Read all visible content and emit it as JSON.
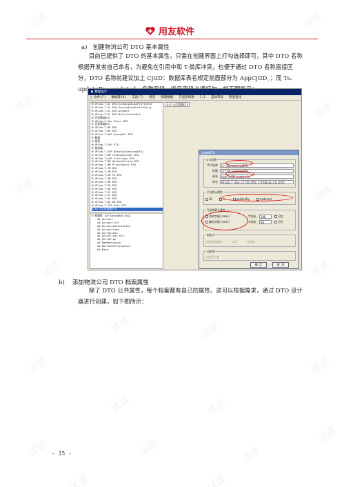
{
  "header": {
    "logo_text": "用友软件",
    "brand_color": "#c81c2a"
  },
  "watermark": "试读",
  "section_a": {
    "label": "a)",
    "heading": "创建物流公司 DTO 基本属性",
    "paragraph": "目前已提供了 DTO 的基本属性，只需在创建界面上打勾选择即可，其中 DTO 名称根据开发者自己命名，为避免在引用中和 T-类库冲突，也便于通过 DTO 名称直接区分，DTO 名称前建议加上 CjtID：数据库表名规定前面部分为 AppCjtID_；而 Ts、updateBy、updated、名称字段、编号字段必须打勾，如下图所示："
  },
  "screenshot": {
    "window_title": "■ 数据设计",
    "menu": [
      "□ 文件(F)",
      "数据库(D)",
      "工具(T)",
      "预览",
      "新建数据",
      "只显示修改",
      "1:1",
      "自动布局",
      "快速查找"
    ],
    "tab_label": "Bill公司管理DTO",
    "tree_items": [
      "⊞ UFida.T.GL DTO.ExchangeLossProfitDto",
      "⊞ UFida.T.GL DTO.PeriodLossProfitCarry",
      "⊞ UFida.T.GL DTO.Account",
      "⊞ UFida.T.GL DTO.MultiColumnSet",
      "⊞ 凭证数据DTO",
      "⊞ UFida.T.Rep Chart DTO",
      "⊞ 凭证数据DTO",
      "⊞ UFida.T.MG DTO",
      "⊞ UFida.T.MG DTO",
      "⊞ UFida.T.RAP QueryMst DTO",
      "⊞ 数据",
      "⊞ 报表",
      "⊞ UFida.T.EAP DTO",
      "⊞ 服务器",
      "⊞ UFida.T.EAP Desktop(DesktopDTO)",
      "⊞ UFida.T.BM CreateAccount DTO",
      "⊞ UFida.T.EAP Privilege DTO",
      "⊞ UFida.T.BM OptionSetting DTO",
      "⊞ UFida.T.BM PrintCenter DTO",
      "⊞ UFida.T.IM DTO",
      "⊞ UFida.T.AM DTO",
      "⊞ UFida.T.AM FA DTO",
      "⊞ UFida.T.AM DTO",
      "⊞ UFida.T.MR DTO",
      "⊞ UFida.T.PR DTO",
      "⊞ UFida.T.AR DTO",
      "⊞ UFida.T.SC DTO",
      "⊞ UFida.T.SI DTO",
      "⊞ UFida.T.AA DTO",
      "⊞ UFida.T.AA DR DTO",
      "⊞ UFida.T.IIM Test DTO",
      "⊟ Bill公司管理DTO"
    ],
    "tree_db_header": "⊟ 数据库 (UFTData0003_001)",
    "tree_db_items": [
      "AA_Account",
      "AA_Account_Ext",
      "AA_AccountAssociation",
      "AA_AccountType",
      "AA_AccrdClass",
      "AA_AccrdClass_Ext",
      "AA_AccrdProp",
      "AA_Baddebtcount",
      "AA_BarCodeInformation",
      "AA_Bank"
    ],
    "dialog": {
      "title": "添加新DTO",
      "group_dto": "DTO信息",
      "fields": [
        {
          "label": "DTO名称",
          "value": "CjtIDLogisticDTO"
        },
        {
          "label": "标题",
          "value": "CjtIDLogisticDTO"
        },
        {
          "label": "表名",
          "value": "AppCjtID_Logistic"
        },
        {
          "label": "命名",
          "value": "UFida.T.App.CjtID.DTO.CjtIDLogisticDTO"
        }
      ],
      "group_platform": "平台默认属性",
      "platform_opts": [
        "ID",
        "Ts",
        "updateBy",
        "updated"
      ],
      "group_optional": "可选的默认属性",
      "optional_opts": [
        {
          "label": "名称字段(name)",
          "len_label": "字段长",
          "len": "200",
          "nullable": "可空"
        },
        {
          "label": "编号字段(code)",
          "len_label": "字段长",
          "len": "50",
          "nullable": "可空"
        }
      ],
      "group_tree": "树定义",
      "tree_opts": [
        "支持树形结构",
        "公用",
        "字段长"
      ],
      "group_auto": "自由项",
      "auto_opts": [
        "自由项个数"
      ],
      "ok": "确 定",
      "cancel": "取 消"
    }
  },
  "section_b": {
    "label": "b)",
    "heading": "添加物流公司 DTO 档案属性",
    "paragraph": "除了 DTO 公共属性，每个档案都有自己的属性。这可以根据需求，通过 DTO 设计器进行创建，如下图所示："
  },
  "footer": {
    "page_number": "- 15 -"
  }
}
